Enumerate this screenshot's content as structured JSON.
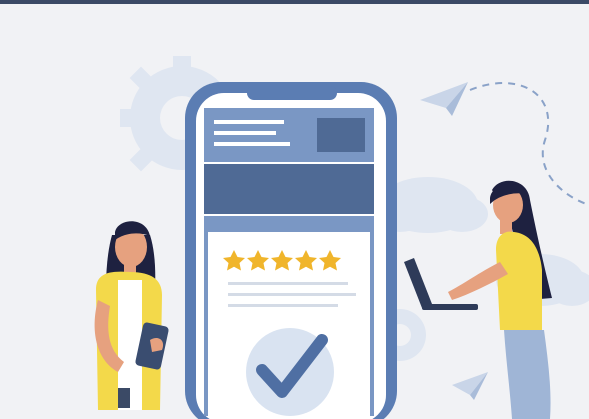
{
  "illustration": {
    "rating": {
      "stars_filled": 5,
      "stars_total": 5
    },
    "status": "check-confirmed",
    "colors": {
      "background": "#f1f2f5",
      "top_bar": "#3b4a66",
      "phone_frame": "#5b7db3",
      "phone_screen": "#ffffff",
      "panel": "#7a97c4",
      "panel_dark": "#4f6a95",
      "accent_star": "#f0b52b",
      "check_circle": "#d9e3f1",
      "check_mark": "#4f6fa3",
      "shirt_yellow": "#f3d94a",
      "hair": "#1e2140",
      "skin": "#e6a17f",
      "soft_shape": "#dfe6f1"
    },
    "icons": [
      "gear-icon",
      "paper-plane-icon",
      "cloud-icon",
      "star-icon",
      "check-icon",
      "tablet-icon",
      "laptop-icon"
    ]
  }
}
